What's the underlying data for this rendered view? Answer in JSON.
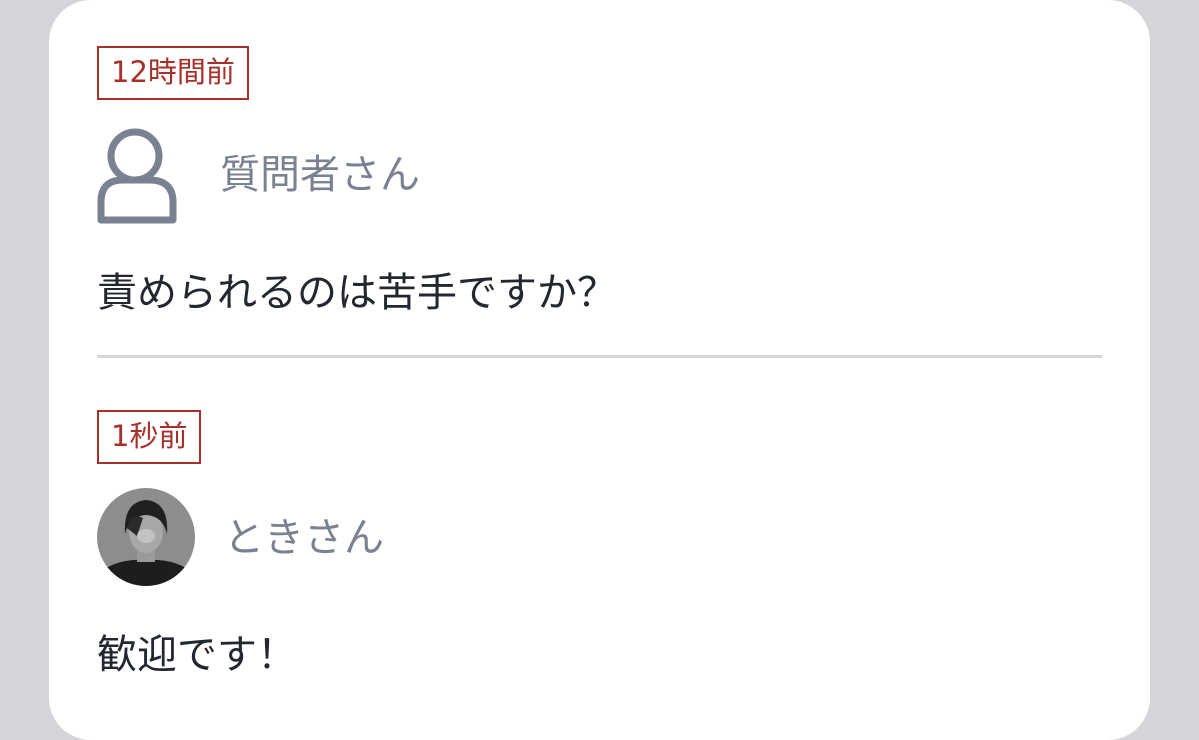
{
  "question": {
    "time_label": "12時間前",
    "author_name": "質問者さん",
    "author_icon": "person-outline-icon",
    "text": "責められるのは苦手ですか？"
  },
  "answer": {
    "time_label": "1秒前",
    "author_name": "ときさん",
    "author_avatar": "profile-photo-avatar",
    "text": "歓迎です！"
  },
  "colors": {
    "background": "#d3d5d9",
    "card": "#ffffff",
    "badge_red": "#a8302a",
    "name_gray": "#7a8190",
    "text_dark": "#232730",
    "divider": "#d5d7da"
  }
}
